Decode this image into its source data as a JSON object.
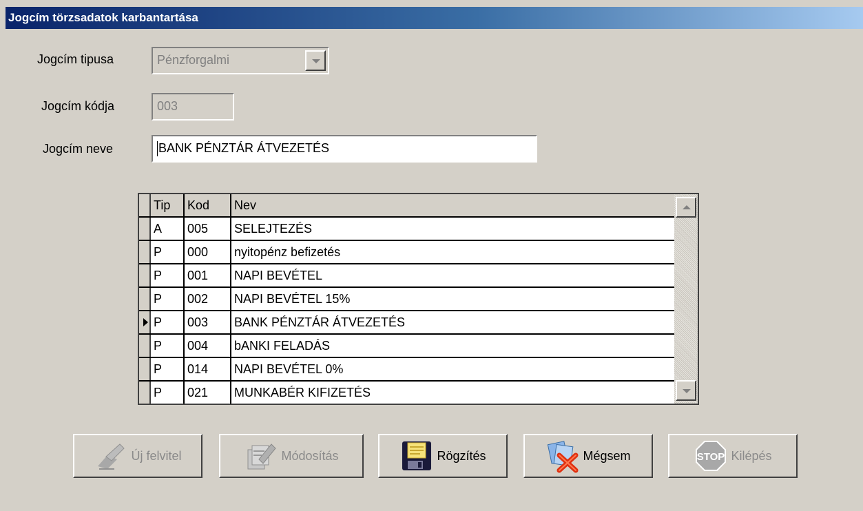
{
  "window": {
    "title": "Jogcím törzsadatok karbantartása"
  },
  "form": {
    "type_label": "Jogcím tipusa",
    "type_value": "Pénzforgalmi",
    "code_label": "Jogcím kódja",
    "code_value": "003",
    "name_label": "Jogcím neve",
    "name_value": "BANK PÉNZTÁR ÁTVEZETÉS"
  },
  "grid": {
    "columns": [
      "Tip",
      "Kod",
      "Nev"
    ],
    "rows": [
      {
        "tip": "A",
        "kod": "005",
        "nev": "SELEJTEZÉS"
      },
      {
        "tip": "P",
        "kod": "000",
        "nev": "nyitopénz befizetés"
      },
      {
        "tip": "P",
        "kod": "001",
        "nev": "NAPI BEVÉTEL"
      },
      {
        "tip": "P",
        "kod": "002",
        "nev": "NAPI BEVÉTEL 15%"
      },
      {
        "tip": "P",
        "kod": "003",
        "nev": "BANK PÉNZTÁR ÁTVEZETÉS"
      },
      {
        "tip": "P",
        "kod": "004",
        "nev": "bANKI FELADÁS"
      },
      {
        "tip": "P",
        "kod": "014",
        "nev": "NAPI BEVÉTEL 0%"
      },
      {
        "tip": "P",
        "kod": "021",
        "nev": "MUNKABÉR KIFIZETÉS"
      }
    ],
    "current_row": 4
  },
  "buttons": {
    "new": {
      "label": "Új felvitel",
      "icon": "pen-writing-icon",
      "enabled": false
    },
    "modify": {
      "label": "Módosítás",
      "icon": "edit-pages-icon",
      "enabled": false
    },
    "save": {
      "label": "Rögzítés",
      "icon": "floppy-disk-icon",
      "enabled": true
    },
    "cancel": {
      "label": "Mégsem",
      "icon": "cancel-x-icon",
      "enabled": true
    },
    "exit": {
      "label": "Kilépés",
      "icon": "stop-sign-icon",
      "enabled": false
    }
  },
  "colors": {
    "titlebar_start": "#0a246a",
    "titlebar_end": "#a6caf0",
    "face": "#d4d0c8",
    "disabled_text": "#808080"
  }
}
